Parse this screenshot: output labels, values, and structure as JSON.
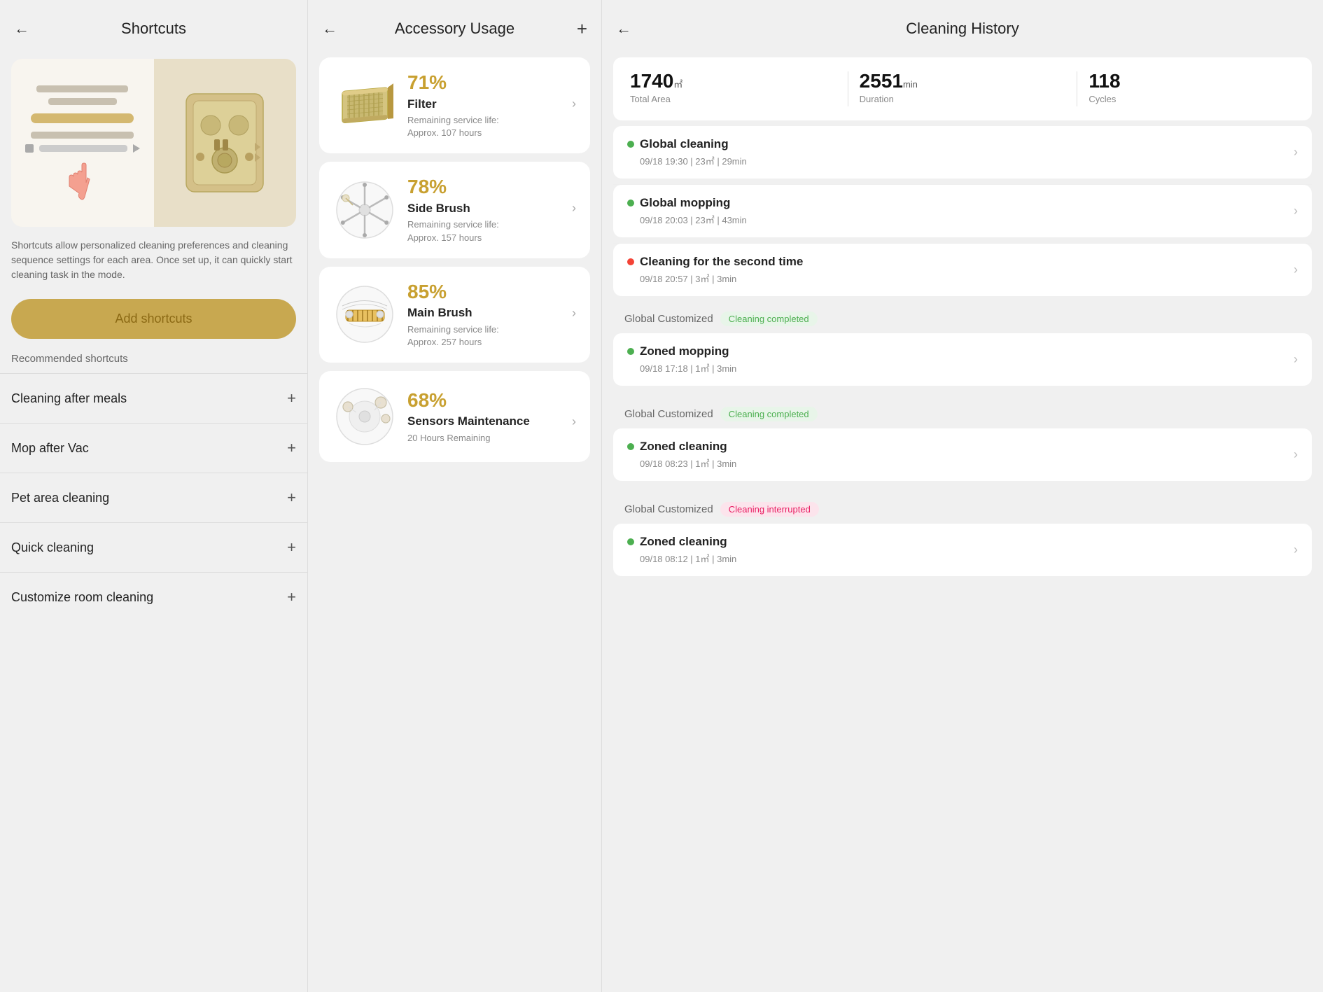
{
  "shortcuts": {
    "title": "Shortcuts",
    "description": "Shortcuts allow personalized cleaning preferences and cleaning sequence settings for each area. Once set up, it can quickly start cleaning task in the mode.",
    "add_button": "Add shortcuts",
    "recommended_label": "Recommended shortcuts",
    "items": [
      {
        "label": "Cleaning after meals",
        "id": "cleaning-after-meals"
      },
      {
        "label": "Mop after Vac",
        "id": "mop-after-vac"
      },
      {
        "label": "Pet area cleaning",
        "id": "pet-area-cleaning"
      },
      {
        "label": "Quick cleaning",
        "id": "quick-cleaning"
      },
      {
        "label": "Customize room cleaning",
        "id": "customize-room-cleaning"
      }
    ]
  },
  "accessory": {
    "title": "Accessory Usage",
    "items": [
      {
        "id": "filter",
        "percent": "71%",
        "name": "Filter",
        "desc_line1": "Remaining service life:",
        "desc_line2": "Approx. 107 hours",
        "icon": "filter"
      },
      {
        "id": "side-brush",
        "percent": "78%",
        "name": "Side Brush",
        "desc_line1": "Remaining service life:",
        "desc_line2": "Approx. 157 hours",
        "icon": "sidebrush"
      },
      {
        "id": "main-brush",
        "percent": "85%",
        "name": "Main Brush",
        "desc_line1": "Remaining service life:",
        "desc_line2": "Approx. 257 hours",
        "icon": "mainbrush"
      },
      {
        "id": "sensors",
        "percent": "68%",
        "name": "Sensors Maintenance",
        "desc_line1": "",
        "desc_line2": "20 Hours Remaining",
        "icon": "sensors"
      }
    ]
  },
  "history": {
    "title": "Cleaning History",
    "stats": {
      "total_area_value": "1740",
      "total_area_unit": "㎡",
      "total_area_label": "Total Area",
      "duration_value": "2551",
      "duration_unit": "min",
      "duration_label": "Duration",
      "cycles_value": "118",
      "cycles_label": "Cycles"
    },
    "groups": [
      {
        "id": "group-standalone-1",
        "header": false,
        "entries": [
          {
            "dot": "green",
            "name": "Global cleaning",
            "meta": "09/18 19:30  |  23㎡  |  29min"
          },
          {
            "dot": "green",
            "name": "Global mopping",
            "meta": "09/18 20:03  |  23㎡  |  43min"
          },
          {
            "dot": "red",
            "name": "Cleaning for the second time",
            "meta": "09/18 20:57  |  3㎡  |  3min"
          }
        ]
      },
      {
        "id": "group-customized-1",
        "header": true,
        "group_label": "Global Customized",
        "badge": "Cleaning completed",
        "badge_type": "completed",
        "entries": [
          {
            "dot": "green",
            "name": "Zoned mopping",
            "meta": "09/18 17:18  |  1㎡  |  3min"
          }
        ]
      },
      {
        "id": "group-customized-2",
        "header": true,
        "group_label": "Global Customized",
        "badge": "Cleaning completed",
        "badge_type": "completed",
        "entries": [
          {
            "dot": "green",
            "name": "Zoned cleaning",
            "meta": "09/18 08:23  |  1㎡  |  3min"
          }
        ]
      },
      {
        "id": "group-customized-3",
        "header": true,
        "group_label": "Global Customized",
        "badge": "Cleaning interrupted",
        "badge_type": "interrupted",
        "entries": [
          {
            "dot": "green",
            "name": "Zoned cleaning",
            "meta": "09/18 08:12  |  1㎡  |  3min"
          }
        ]
      }
    ]
  }
}
